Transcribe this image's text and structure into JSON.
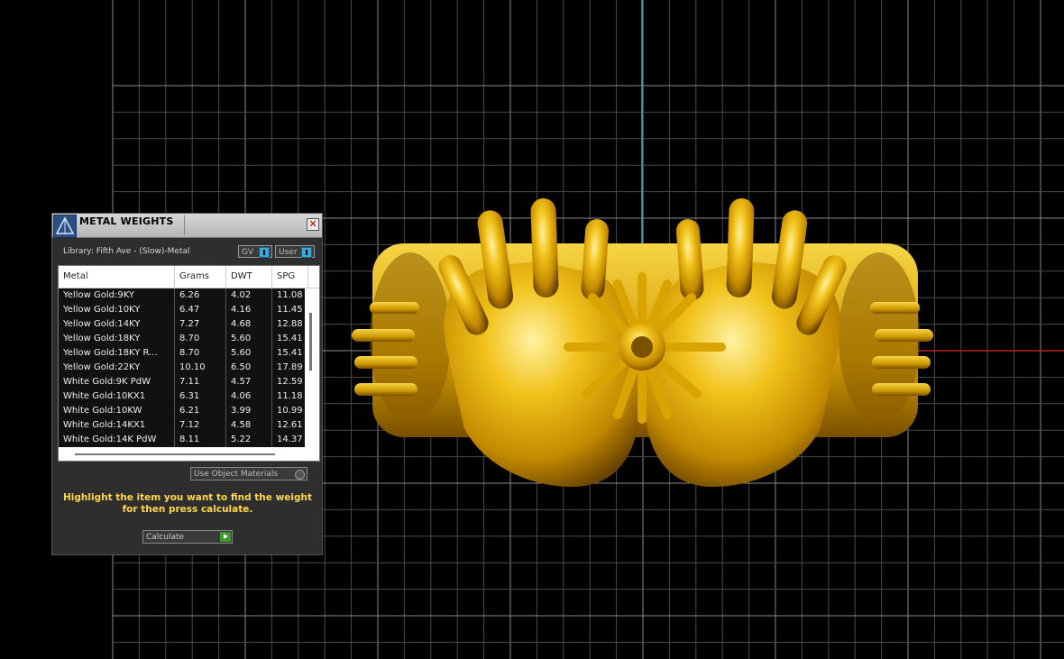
{
  "panel": {
    "title": "METAL WEIGHTS",
    "close_glyph": "✕",
    "library_label": "Library: Fifth Ave - (Slow)-Metal",
    "gv_toggle": "GV",
    "user_toggle": "User",
    "use_object_materials": "Use Object Materials",
    "hint": "Highlight the item you want to find the weight for then press calculate.",
    "calculate": "Calculate",
    "colors": {
      "hint": "#ffd84a",
      "toggle_knob": "#3aa9d8",
      "go_button": "#3a9a2a"
    }
  },
  "table": {
    "headers": [
      "Metal",
      "Grams",
      "DWT",
      "SPG"
    ],
    "rows": [
      [
        "Yellow Gold:9KY",
        "6.26",
        "4.02",
        "11.08"
      ],
      [
        "Yellow Gold:10KY",
        "6.47",
        "4.16",
        "11.45"
      ],
      [
        "Yellow Gold:14KY",
        "7.27",
        "4.68",
        "12.88"
      ],
      [
        "Yellow Gold:18KY",
        "8.70",
        "5.60",
        "15.41"
      ],
      [
        "Yellow Gold:18KY R...",
        "8.70",
        "5.60",
        "15.41"
      ],
      [
        "Yellow Gold:22KY",
        "10.10",
        "6.50",
        "17.89"
      ],
      [
        "White Gold:9K PdW",
        "7.11",
        "4.57",
        "12.59"
      ],
      [
        "White Gold:10KX1",
        "6.31",
        "4.06",
        "11.18"
      ],
      [
        "White Gold:10KW",
        "6.21",
        "3.99",
        "10.99"
      ],
      [
        "White Gold:14KX1",
        "7.12",
        "4.58",
        "12.61"
      ],
      [
        "White Gold:14K PdW",
        "8.11",
        "5.22",
        "14.37"
      ]
    ]
  },
  "viewport": {
    "colors": {
      "grid": "#4a4a4a",
      "background": "#000000",
      "axis_y": "#2fa8c8",
      "axis_x": "#c02020",
      "model": "#e0a800"
    }
  }
}
